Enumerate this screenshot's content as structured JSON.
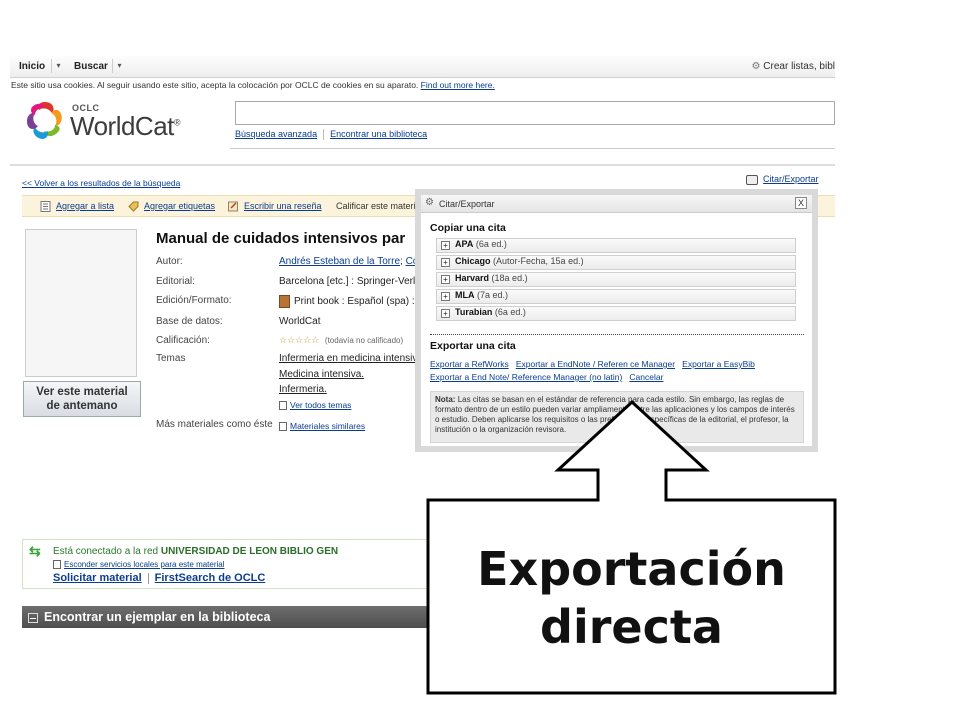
{
  "menu": {
    "inicio": "Inicio",
    "buscar": "Buscar",
    "dropdown_glyph": "▾",
    "right_text": "Crear listas, bibl"
  },
  "cookie_notice": {
    "text": "Este sitio usa cookies. Al seguir usando este sitio, acepta la colocación por OCLC de cookies en su aparato.",
    "link": "Find out more here."
  },
  "logo": {
    "oclc": "OCLC",
    "name": "WorldCat",
    "mark": "®"
  },
  "search": {
    "value": "",
    "advanced_link": "Búsqueda avanzada",
    "library_link": "Encontrar una biblioteca"
  },
  "nav": {
    "back_link": "<< Volver a los resultados de la búsqueda",
    "cite_export": "Citar/Exportar"
  },
  "actions": {
    "add_list": "Agregar a lista",
    "add_tags": "Agregar etiquetas",
    "write_review": "Escribir una reseña",
    "rate_label": "Calificar este material:"
  },
  "record": {
    "title": "Manual de cuidados intensivos par",
    "see_button": [
      "Ver este material",
      "de antemano"
    ],
    "labels": {
      "author": "Autor:",
      "publisher": "Editorial:",
      "edition": "Edición/Formato:",
      "database": "Base de datos:",
      "rating": "Calificación:",
      "subjects": "Temas",
      "more": "Más materiales como éste"
    },
    "values": {
      "author_1": "Andrés Esteban de la Torre",
      "author_sep": ";",
      "author_2": "Co",
      "publisher": "Barcelona [etc.] : Springer-Verla",
      "edition": "Print book : Español (spa) :",
      "database": "WorldCat",
      "stars": "☆☆☆☆☆",
      "rating_note": "(todavía no calificado)",
      "subjects": [
        "Infermeria en medicina intensiva",
        "Medicina intensiva.",
        "Infermeria."
      ],
      "see_all_subjects": "Ver todos temas",
      "similar": "Materiales similares"
    }
  },
  "network": {
    "prefix": "Está conectado a la red",
    "library": "UNIVERSIDAD DE LEON BIBLIO GEN",
    "hide_link": "Esconder servicios locales para este material",
    "request": "Solicitar material",
    "firstsearch": "FirstSearch de OCLC"
  },
  "find_copy": {
    "title": "Encontrar un ejemplar en la biblioteca"
  },
  "dialog": {
    "title": "Citar/Exportar",
    "close": "X",
    "copy_heading": "Copiar una cita",
    "styles": [
      {
        "name": "APA",
        "edition": "(6a ed.)"
      },
      {
        "name": "Chicago",
        "edition": "(Autor-Fecha, 15a ed.)"
      },
      {
        "name": "Harvard",
        "edition": "(18a ed.)"
      },
      {
        "name": "MLA",
        "edition": "(7a ed.)"
      },
      {
        "name": "Turabian",
        "edition": "(6a ed.)"
      }
    ],
    "export_heading": "Exportar una cita",
    "export_links": {
      "refworks": "Exportar a RefWorks",
      "endnote": "Exportar a EndNote / Referen ce Manager",
      "easybib": "Exportar a EasyBib",
      "endnote_nolatin": "Exportar a End Note/ Reference Manager (no latin)",
      "cancel": "Cancelar"
    },
    "note_label": "Nota:",
    "note_text": "Las citas se basan en el estándar de referencia para cada estilo. Sin embargo, las reglas de formato dentro de un estilo pueden variar ampliamente entre las aplicaciones y los campos de interés o estudio. Deben aplicarse los requisitos o las preferencias específicas de la editorial, el profesor, la institución o la organización revisora."
  },
  "callout": {
    "line1": "Exportación",
    "line2": "directa"
  },
  "colors": {
    "link": "#0a3d91",
    "network_green": "#2a7a2a",
    "toolbar_bg": "#fbf3dc",
    "dark_bar": "#555555"
  }
}
